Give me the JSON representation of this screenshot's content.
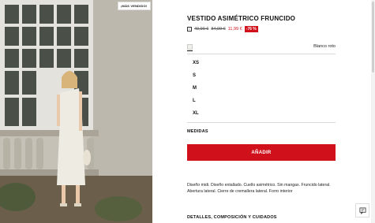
{
  "photo": {
    "badge": "¡MÁS VENDIDO!",
    "alt_icon": "product-photo"
  },
  "product": {
    "title": "VESTIDO ASIMÉTRICO FRUNCIDO",
    "price_original": "49,99 €",
    "price_previous": "84,99 €",
    "price_sale": "11,99 €",
    "discount": "-76 %",
    "color_name": "Blanco roto",
    "swatch_color": "#f1efe9"
  },
  "sizes": [
    "XS",
    "S",
    "M",
    "L",
    "XL"
  ],
  "measures_label": "MEDIDAS",
  "add_button": "AÑADIR",
  "description": "Diseño midi. Diseño entallado. Cuello asimétrico. Sin mangas. Fruncido lateral. Abertura lateral. Cierre de cremallera lateral. Forro interior",
  "details_label": "DETALLES, COMPOSICIÓN Y CUIDADOS",
  "colors": {
    "accent": "#d0101a"
  }
}
